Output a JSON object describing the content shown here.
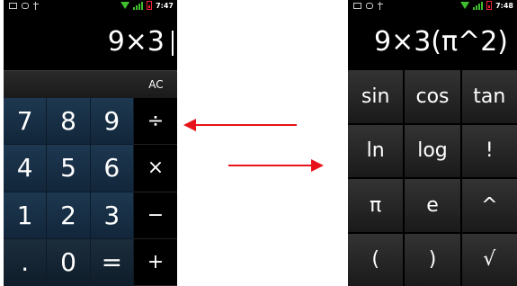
{
  "left_phone": {
    "status": {
      "time": "7:47"
    },
    "display": "9×3",
    "clear_label": "AC",
    "numpad": [
      "7",
      "8",
      "9",
      "4",
      "5",
      "6",
      "1",
      "2",
      "3",
      ".",
      "0",
      "="
    ],
    "operators": [
      "÷",
      "×",
      "−",
      "+"
    ]
  },
  "right_phone": {
    "status": {
      "time": "7:48"
    },
    "display": "9×3(π^2)",
    "advanced": [
      "sin",
      "cos",
      "tan",
      "ln",
      "log",
      "!",
      "π",
      "e",
      "^",
      "(",
      ")",
      "√"
    ]
  },
  "colors": {
    "arrow": "#e8121a",
    "numpad": "#1d3850",
    "signal": "#3fbf2f",
    "battery": "#e23"
  },
  "icons": [
    "mail-icon",
    "android-icon",
    "usb-icon",
    "wifi-icon",
    "signal-icon",
    "battery-icon"
  ]
}
